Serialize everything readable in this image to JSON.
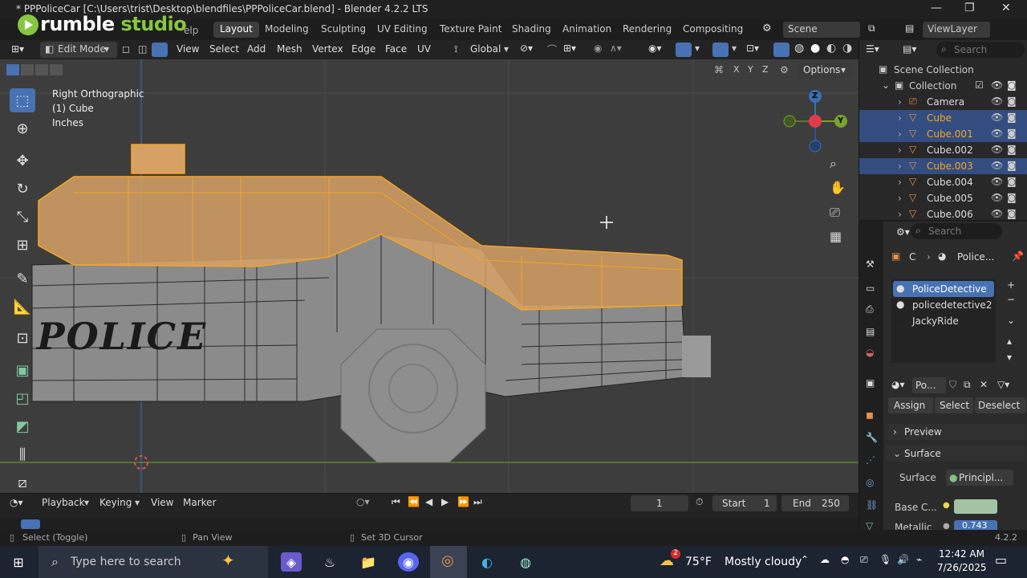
{
  "window": {
    "title": "* PPPoliceCar [C:\\Users\\trist\\Desktop\\blendfiles\\PPPoliceCar.blend] - Blender 4.2.2 LTS",
    "minimize": "—",
    "maximize": "❐",
    "close": "✕"
  },
  "watermark": {
    "brand_left": "rumble",
    "brand_right": "studio",
    "menu_fragment": "elp"
  },
  "workspaces": [
    "Layout",
    "Modeling",
    "Sculpting",
    "UV Editing",
    "Texture Paint",
    "Shading",
    "Animation",
    "Rendering",
    "Compositing"
  ],
  "scene": {
    "name": "Scene",
    "view_layer": "ViewLayer"
  },
  "header": {
    "mode": "Edit Mode",
    "menus": [
      "View",
      "Select",
      "Add",
      "Mesh",
      "Vertex",
      "Edge",
      "Face",
      "UV"
    ],
    "transform": "Global",
    "options": "Options",
    "axes": [
      "X",
      "Y",
      "Z"
    ]
  },
  "overlay_text": {
    "view": "Right Orthographic",
    "object": "(1) Cube",
    "units": "Inches"
  },
  "gizmo": {
    "z": "Z",
    "y": "Y"
  },
  "car_text": "POLICE",
  "outliner": {
    "search_placeholder": "Search",
    "scene_collection": "Scene Collection",
    "collection": "Collection",
    "items": [
      {
        "name": "Camera",
        "selected": false,
        "orange": false
      },
      {
        "name": "Cube",
        "selected": true,
        "orange": true
      },
      {
        "name": "Cube.001",
        "selected": true,
        "orange": true
      },
      {
        "name": "Cube.002",
        "selected": false,
        "orange": false
      },
      {
        "name": "Cube.003",
        "selected": true,
        "orange": true
      },
      {
        "name": "Cube.004",
        "selected": false,
        "orange": false
      },
      {
        "name": "Cube.005",
        "selected": false,
        "orange": false
      },
      {
        "name": "Cube.006",
        "selected": false,
        "orange": false
      }
    ]
  },
  "properties": {
    "search_placeholder": "Search",
    "breadcrumb_c": "C",
    "breadcrumb_mat": "Police...",
    "materials": [
      "PoliceDetective",
      "policedetective2",
      "JackyRide"
    ],
    "slot_name": "Po...",
    "assign": "Assign",
    "select": "Select",
    "deselect": "Deselect",
    "preview": "Preview",
    "surface_panel": "Surface",
    "surface_label": "Surface",
    "surface_value": "Principl...",
    "base_color_label": "Base C...",
    "base_color": "#a3c4a3",
    "metallic_label": "Metallic",
    "metallic_value": "0.743"
  },
  "timeline": {
    "menus": [
      "Playback",
      "Keying",
      "View",
      "Marker"
    ],
    "frame": "1",
    "start_label": "Start",
    "start": "1",
    "end_label": "End",
    "end": "250"
  },
  "statusbar": {
    "select": "Select (Toggle)",
    "pan": "Pan View",
    "cursor": "Set 3D Cursor",
    "version": "4.2.2"
  },
  "taskbar": {
    "search_placeholder": "Type here to search",
    "weather_temp": "75°F",
    "weather_desc": "Mostly cloudy",
    "weather_badge": "2",
    "time": "12:42 AM",
    "date": "7/26/2025"
  },
  "colors": {
    "accent": "#4772b3",
    "selection_orange": "#f5a623",
    "outliner_select": "#334d80"
  }
}
